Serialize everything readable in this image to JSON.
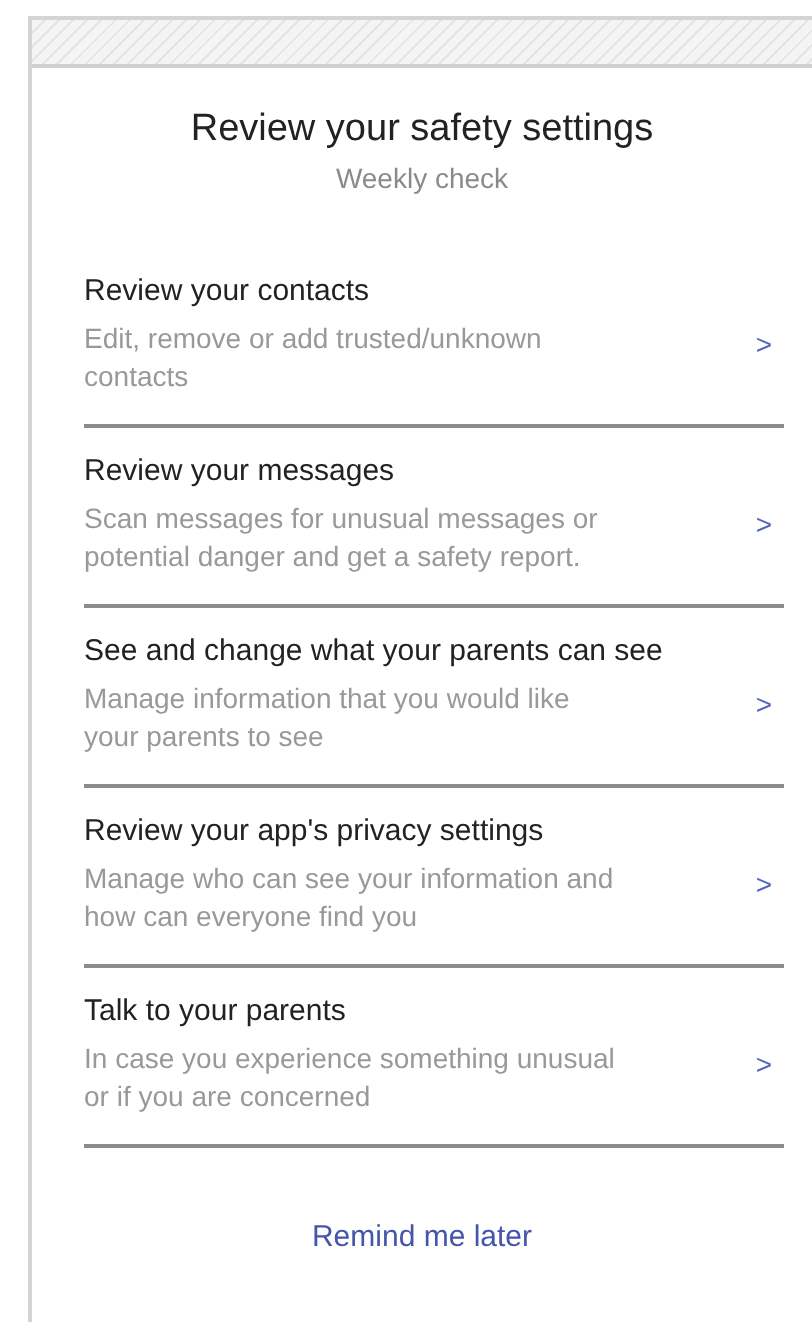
{
  "header": {
    "title": "Review your safety settings",
    "subtitle": "Weekly check"
  },
  "items": [
    {
      "title": "Review your contacts",
      "description": "Edit, remove or add trusted/unknown contacts",
      "chevron": ">"
    },
    {
      "title": "Review your messages",
      "description": "Scan messages for unusual messages or potential danger and get a safety report.",
      "chevron": ">"
    },
    {
      "title": "See and change what your parents can see",
      "description": "Manage information that you would like your parents to see",
      "chevron": ">"
    },
    {
      "title": "Review your app's privacy settings",
      "description": "Manage who can see your information and how can everyone find you",
      "chevron": ">"
    },
    {
      "title": "Talk to your parents",
      "description": "In case you experience something unusual or if you are concerned",
      "chevron": ">"
    }
  ],
  "footer_link": "Remind me later"
}
